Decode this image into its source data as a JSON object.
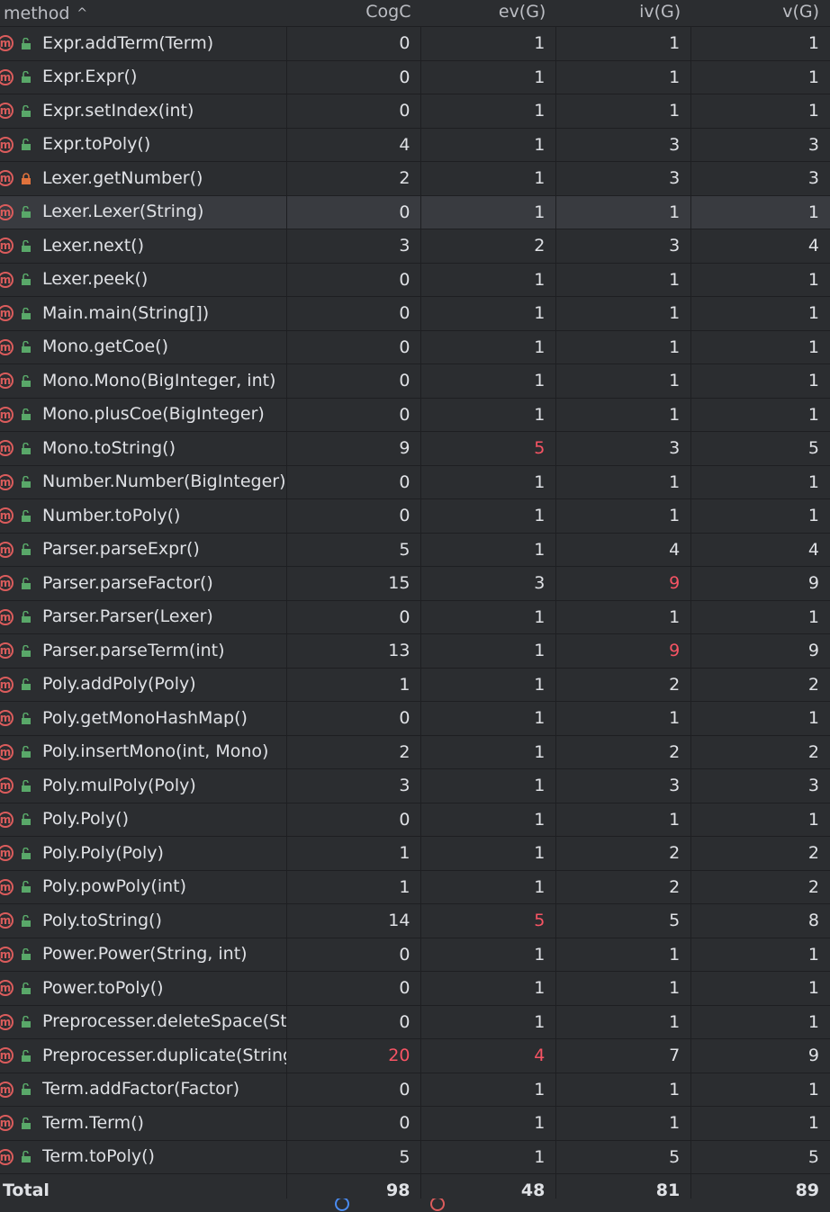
{
  "columns": {
    "method": "method",
    "cogc": "CogC",
    "evg": "ev(G)",
    "ivg": "iv(G)",
    "vg": "v(G)"
  },
  "rows": [
    {
      "method": "Expr.addTerm(Term)",
      "cogc": "0",
      "evg": "1",
      "ivg": "1",
      "vg": "1",
      "lock": "open"
    },
    {
      "method": "Expr.Expr()",
      "cogc": "0",
      "evg": "1",
      "ivg": "1",
      "vg": "1",
      "lock": "open"
    },
    {
      "method": "Expr.setIndex(int)",
      "cogc": "0",
      "evg": "1",
      "ivg": "1",
      "vg": "1",
      "lock": "open"
    },
    {
      "method": "Expr.toPoly()",
      "cogc": "4",
      "evg": "1",
      "ivg": "3",
      "vg": "3",
      "lock": "open"
    },
    {
      "method": "Lexer.getNumber()",
      "cogc": "2",
      "evg": "1",
      "ivg": "3",
      "vg": "3",
      "lock": "closed"
    },
    {
      "method": "Lexer.Lexer(String)",
      "cogc": "0",
      "evg": "1",
      "ivg": "1",
      "vg": "1",
      "lock": "open",
      "highlight": true
    },
    {
      "method": "Lexer.next()",
      "cogc": "3",
      "evg": "2",
      "ivg": "3",
      "vg": "4",
      "lock": "open"
    },
    {
      "method": "Lexer.peek()",
      "cogc": "0",
      "evg": "1",
      "ivg": "1",
      "vg": "1",
      "lock": "open"
    },
    {
      "method": "Main.main(String[])",
      "cogc": "0",
      "evg": "1",
      "ivg": "1",
      "vg": "1",
      "lock": "open"
    },
    {
      "method": "Mono.getCoe()",
      "cogc": "0",
      "evg": "1",
      "ivg": "1",
      "vg": "1",
      "lock": "open"
    },
    {
      "method": "Mono.Mono(BigInteger, int)",
      "cogc": "0",
      "evg": "1",
      "ivg": "1",
      "vg": "1",
      "lock": "open"
    },
    {
      "method": "Mono.plusCoe(BigInteger)",
      "cogc": "0",
      "evg": "1",
      "ivg": "1",
      "vg": "1",
      "lock": "open"
    },
    {
      "method": "Mono.toString()",
      "cogc": "9",
      "evg": "5",
      "ivg": "3",
      "vg": "5",
      "lock": "open",
      "red": [
        "evg"
      ]
    },
    {
      "method": "Number.Number(BigInteger)",
      "cogc": "0",
      "evg": "1",
      "ivg": "1",
      "vg": "1",
      "lock": "open"
    },
    {
      "method": "Number.toPoly()",
      "cogc": "0",
      "evg": "1",
      "ivg": "1",
      "vg": "1",
      "lock": "open"
    },
    {
      "method": "Parser.parseExpr()",
      "cogc": "5",
      "evg": "1",
      "ivg": "4",
      "vg": "4",
      "lock": "open"
    },
    {
      "method": "Parser.parseFactor()",
      "cogc": "15",
      "evg": "3",
      "ivg": "9",
      "vg": "9",
      "lock": "open",
      "red": [
        "ivg"
      ]
    },
    {
      "method": "Parser.Parser(Lexer)",
      "cogc": "0",
      "evg": "1",
      "ivg": "1",
      "vg": "1",
      "lock": "open"
    },
    {
      "method": "Parser.parseTerm(int)",
      "cogc": "13",
      "evg": "1",
      "ivg": "9",
      "vg": "9",
      "lock": "open",
      "red": [
        "ivg"
      ]
    },
    {
      "method": "Poly.addPoly(Poly)",
      "cogc": "1",
      "evg": "1",
      "ivg": "2",
      "vg": "2",
      "lock": "open"
    },
    {
      "method": "Poly.getMonoHashMap()",
      "cogc": "0",
      "evg": "1",
      "ivg": "1",
      "vg": "1",
      "lock": "open"
    },
    {
      "method": "Poly.insertMono(int, Mono)",
      "cogc": "2",
      "evg": "1",
      "ivg": "2",
      "vg": "2",
      "lock": "open"
    },
    {
      "method": "Poly.mulPoly(Poly)",
      "cogc": "3",
      "evg": "1",
      "ivg": "3",
      "vg": "3",
      "lock": "open"
    },
    {
      "method": "Poly.Poly()",
      "cogc": "0",
      "evg": "1",
      "ivg": "1",
      "vg": "1",
      "lock": "open"
    },
    {
      "method": "Poly.Poly(Poly)",
      "cogc": "1",
      "evg": "1",
      "ivg": "2",
      "vg": "2",
      "lock": "open"
    },
    {
      "method": "Poly.powPoly(int)",
      "cogc": "1",
      "evg": "1",
      "ivg": "2",
      "vg": "2",
      "lock": "open"
    },
    {
      "method": "Poly.toString()",
      "cogc": "14",
      "evg": "5",
      "ivg": "5",
      "vg": "8",
      "lock": "open",
      "red": [
        "evg"
      ]
    },
    {
      "method": "Power.Power(String, int)",
      "cogc": "0",
      "evg": "1",
      "ivg": "1",
      "vg": "1",
      "lock": "open"
    },
    {
      "method": "Power.toPoly()",
      "cogc": "0",
      "evg": "1",
      "ivg": "1",
      "vg": "1",
      "lock": "open"
    },
    {
      "method": "Preprocesser.deleteSpace(St",
      "cogc": "0",
      "evg": "1",
      "ivg": "1",
      "vg": "1",
      "lock": "open"
    },
    {
      "method": "Preprocesser.duplicate(String",
      "cogc": "20",
      "evg": "4",
      "ivg": "7",
      "vg": "9",
      "lock": "open",
      "red": [
        "cogc",
        "evg"
      ]
    },
    {
      "method": "Term.addFactor(Factor)",
      "cogc": "0",
      "evg": "1",
      "ivg": "1",
      "vg": "1",
      "lock": "open"
    },
    {
      "method": "Term.Term()",
      "cogc": "0",
      "evg": "1",
      "ivg": "1",
      "vg": "1",
      "lock": "open"
    },
    {
      "method": "Term.toPoly()",
      "cogc": "5",
      "evg": "1",
      "ivg": "5",
      "vg": "5",
      "lock": "open"
    }
  ],
  "total": {
    "label": "Total",
    "cogc": "98",
    "evg": "48",
    "ivg": "81",
    "vg": "89"
  },
  "icons": {
    "method": "method-icon",
    "lock_open": "unlocked-icon",
    "lock_closed": "locked-icon",
    "sort": "sort-ascending-icon"
  },
  "colors": {
    "background": "#2b2d30",
    "method_icon": "#db5c5c",
    "lock_open": "#59a869",
    "lock_closed": "#e0723c",
    "threshold_red": "#f75464"
  }
}
